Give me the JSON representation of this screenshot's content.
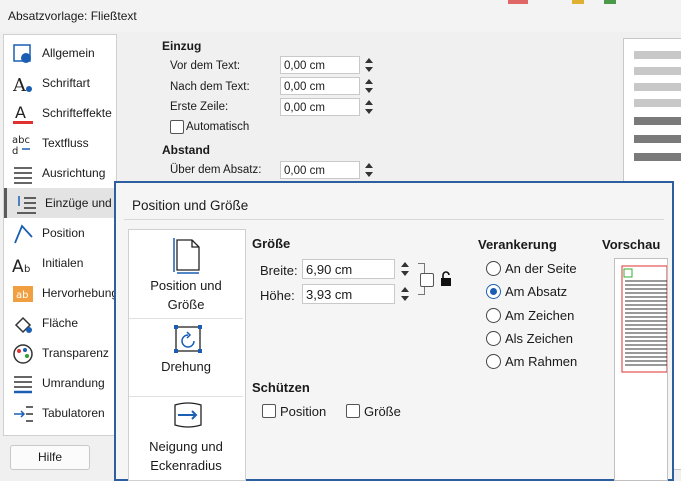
{
  "window": {
    "title": "Absatzvorlage: Fließtext"
  },
  "sidebar": {
    "items": [
      {
        "label": "Allgemein",
        "icon": "general-icon"
      },
      {
        "label": "Schriftart",
        "icon": "font-icon"
      },
      {
        "label": "Schrifteffekte",
        "icon": "font-effects-icon"
      },
      {
        "label": "Textfluss",
        "icon": "text-flow-icon"
      },
      {
        "label": "Ausrichtung",
        "icon": "alignment-icon"
      },
      {
        "label": "Einzüge und A",
        "icon": "indents-icon"
      },
      {
        "label": "Position",
        "icon": "position-icon"
      },
      {
        "label": "Initialen",
        "icon": "initials-icon"
      },
      {
        "label": "Hervorhebung",
        "icon": "highlight-icon"
      },
      {
        "label": "Fläche",
        "icon": "area-icon"
      },
      {
        "label": "Transparenz",
        "icon": "transparency-icon"
      },
      {
        "label": "Umrandung",
        "icon": "borders-icon"
      },
      {
        "label": "Tabulatoren",
        "icon": "tabs-icon"
      }
    ]
  },
  "footer": {
    "help_label": "Hilfe"
  },
  "indent": {
    "heading": "Einzug",
    "before_text_label": "Vor dem Text:",
    "before_text_value": "0,00 cm",
    "after_text_label": "Nach dem Text:",
    "after_text_value": "0,00 cm",
    "first_line_label": "Erste Zeile:",
    "first_line_value": "0,00 cm",
    "automatic_label": "Automatisch"
  },
  "spacing": {
    "heading": "Abstand",
    "above_label": "Über dem Absatz:",
    "above_value": "0,00 cm"
  },
  "overlay": {
    "title": "Position und Größe",
    "tabs": [
      {
        "label1": "Position und",
        "label2": "Größe"
      },
      {
        "label1": "Drehung",
        "label2": ""
      },
      {
        "label1": "Neigung und",
        "label2": "Eckenradius"
      }
    ],
    "size": {
      "heading": "Größe",
      "width_label": "Breite:",
      "width_value": "6,90 cm",
      "height_label": "Höhe:",
      "height_value": "3,93 cm"
    },
    "protect": {
      "heading": "Schützen",
      "position_label": "Position",
      "size_label": "Größe"
    },
    "anchor": {
      "heading": "Verankerung",
      "options": [
        "An der Seite",
        "Am Absatz",
        "Am Zeichen",
        "Als Zeichen",
        "Am Rahmen"
      ],
      "selected": "Am Absatz"
    },
    "preview_heading": "Vorschau",
    "accent_color": "#2d5ea0",
    "radio_color": "#1a5fb4"
  }
}
